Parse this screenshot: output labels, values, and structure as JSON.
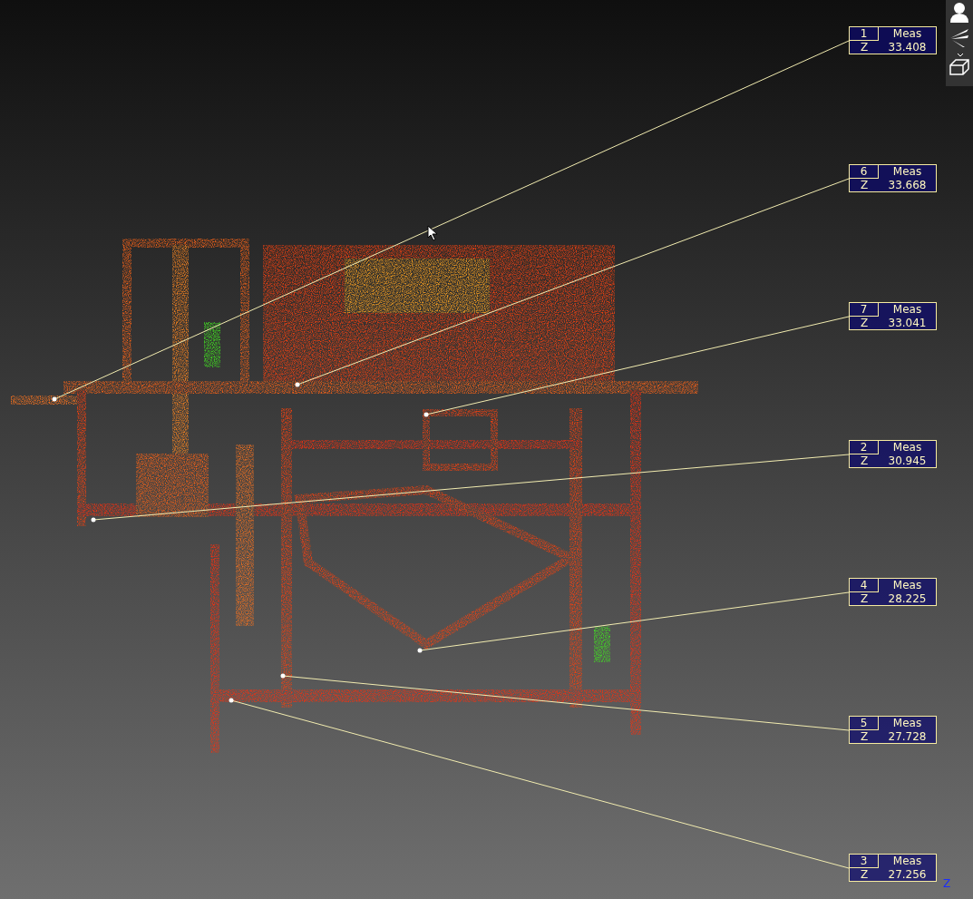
{
  "labels": [
    {
      "index": "1",
      "title": "Meas",
      "axis": "Z",
      "value": "33.408"
    },
    {
      "index": "6",
      "title": "Meas",
      "axis": "Z",
      "value": "33.668"
    },
    {
      "index": "7",
      "title": "Meas",
      "axis": "Z",
      "value": "33.041"
    },
    {
      "index": "2",
      "title": "Meas",
      "axis": "Z",
      "value": "30.945"
    },
    {
      "index": "4",
      "title": "Meas",
      "axis": "Z",
      "value": "28.225"
    },
    {
      "index": "5",
      "title": "Meas",
      "axis": "Z",
      "value": "27.728"
    },
    {
      "index": "3",
      "title": "Meas",
      "axis": "Z",
      "value": "27.256"
    }
  ],
  "axis_indicator": {
    "label": "Z"
  }
}
